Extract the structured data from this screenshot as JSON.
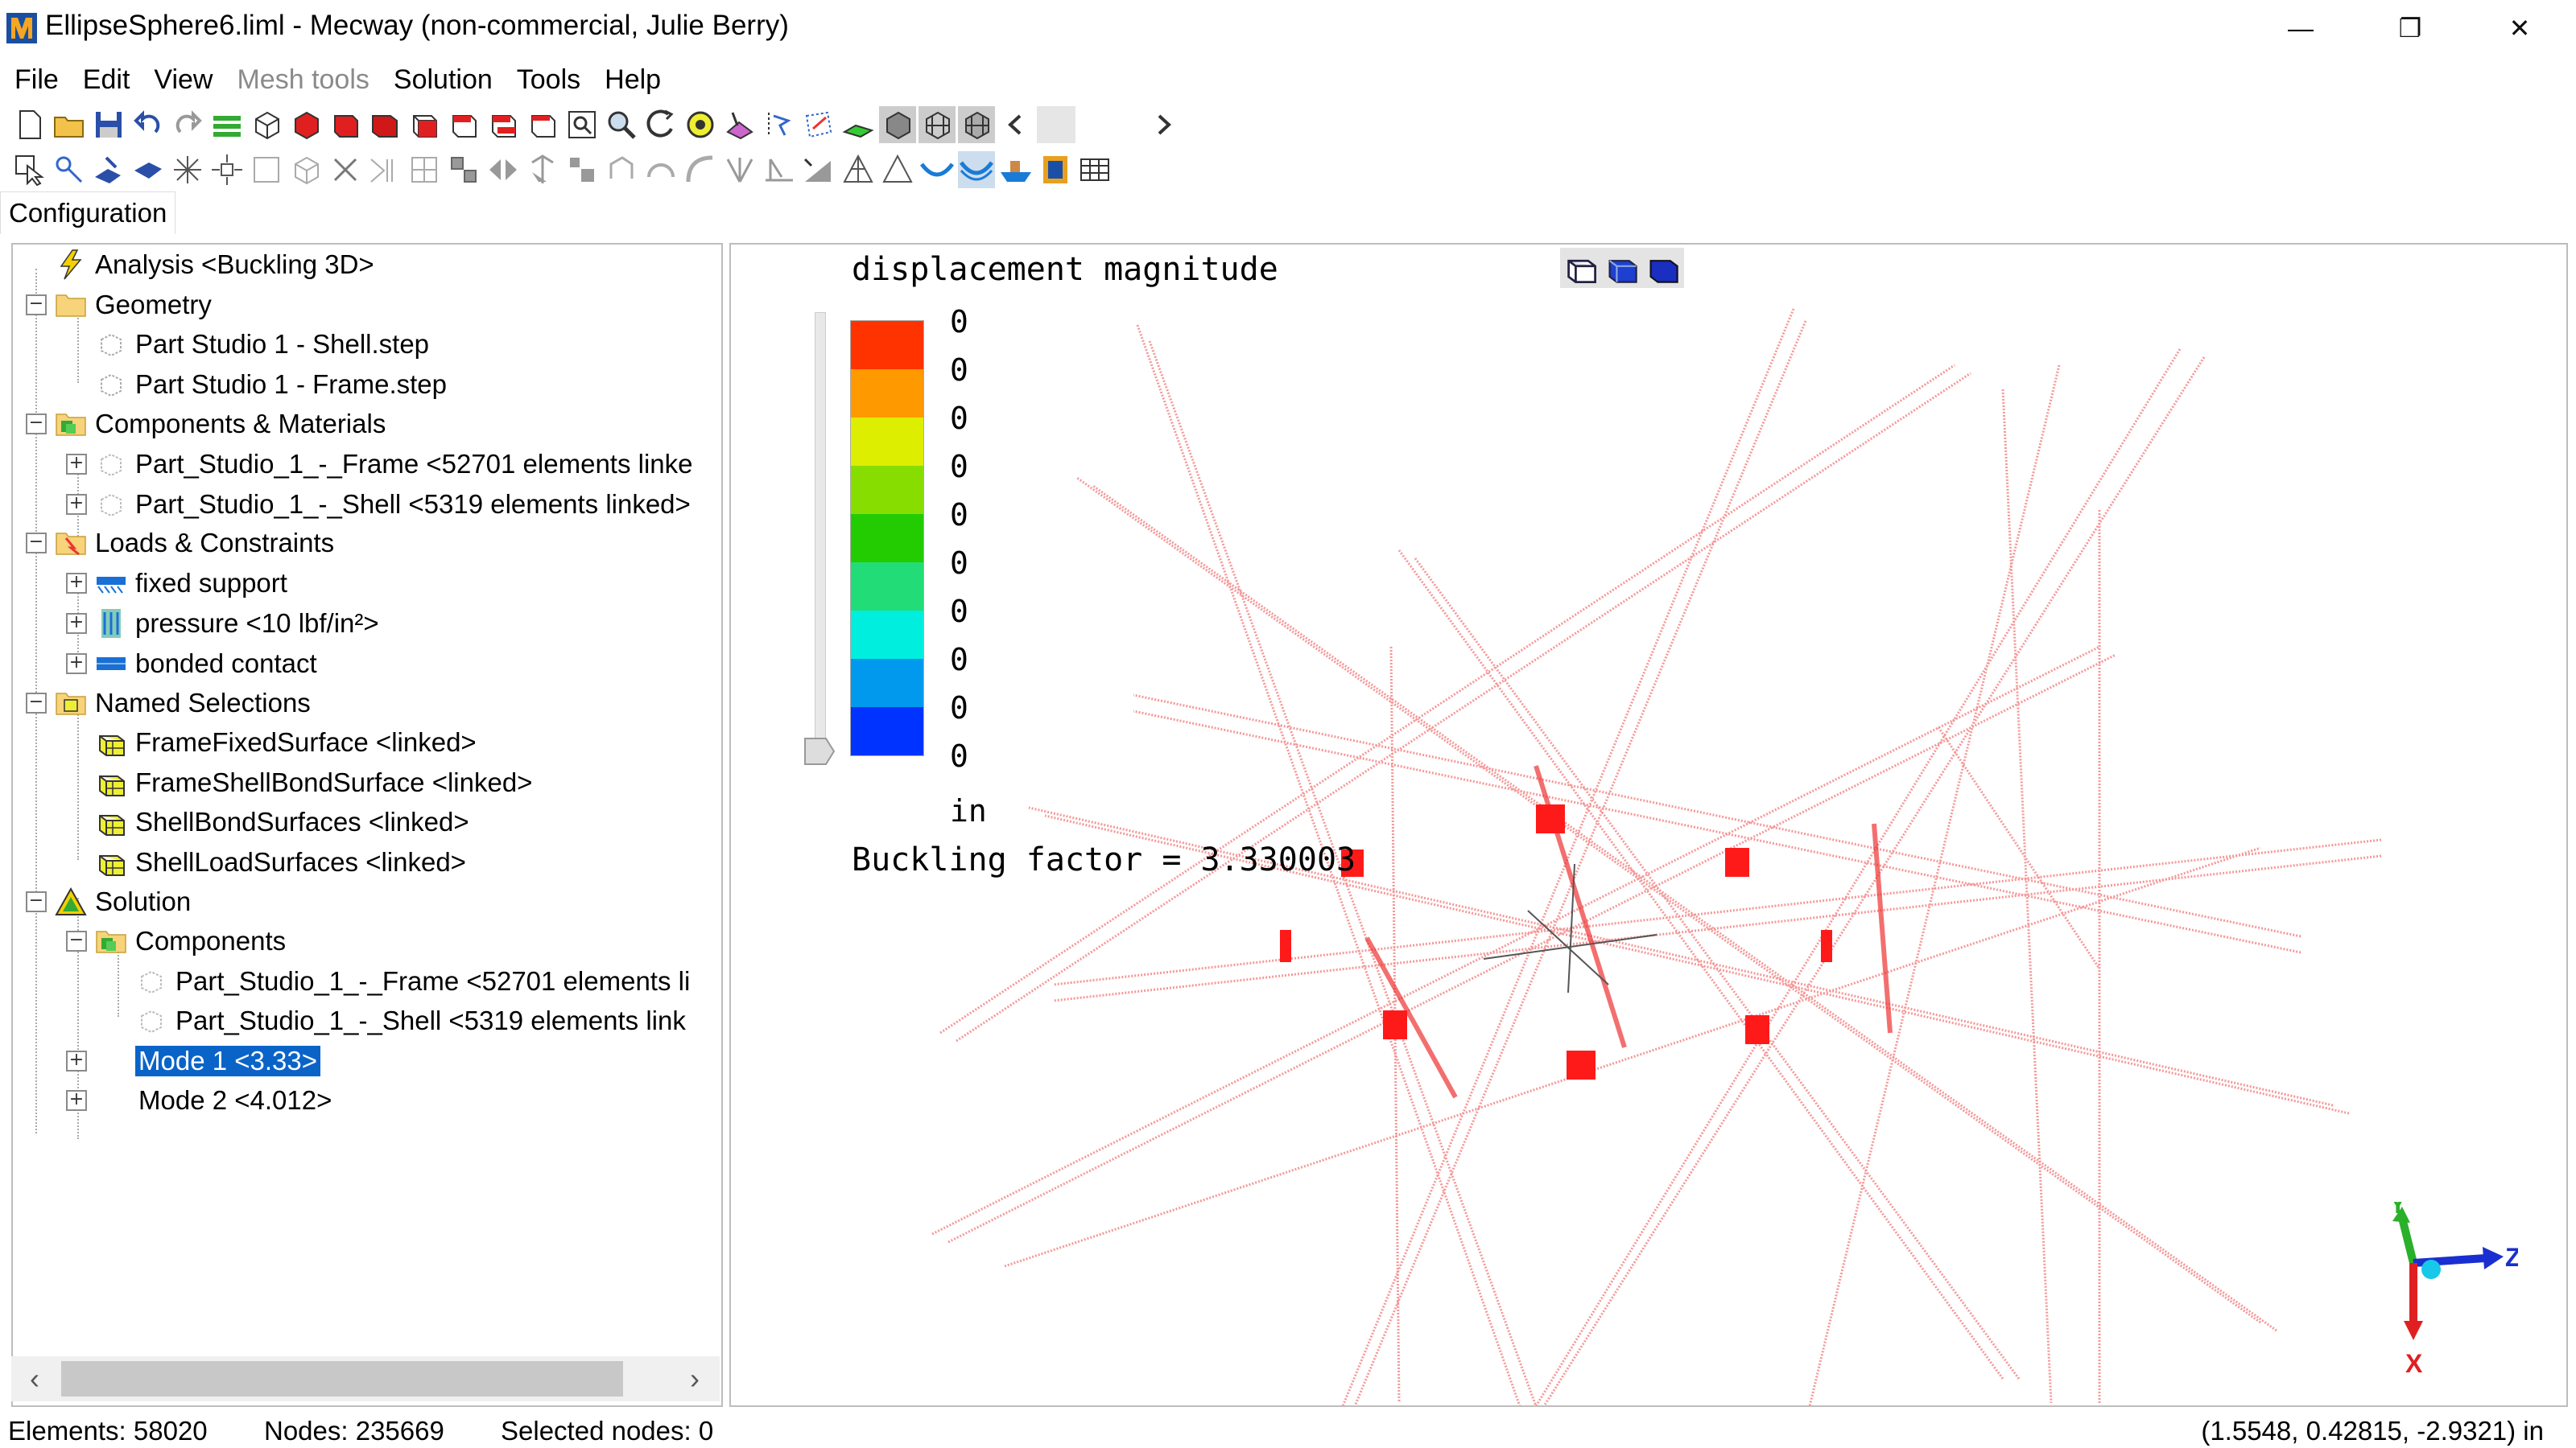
{
  "window": {
    "title": "EllipseSphere6.liml - Mecway (non-commercial, Julie Berry)",
    "minimize": "—",
    "restore": "❐",
    "close": "✕"
  },
  "menu": [
    "File",
    "Edit",
    "View",
    "Mesh tools",
    "Solution",
    "Tools",
    "Help"
  ],
  "tabs": {
    "configuration": "Configuration"
  },
  "tree": {
    "analysis": "Analysis <Buckling 3D>",
    "geometry": "Geometry",
    "geometry_items": [
      "Part Studio 1 - Shell.step",
      "Part Studio 1 - Frame.step"
    ],
    "components_materials": "Components & Materials",
    "component_items": [
      "Part_Studio_1_-_Frame <52701 elements linke",
      "Part_Studio_1_-_Shell <5319 elements linked>"
    ],
    "loads_constraints": "Loads & Constraints",
    "load_items": [
      "fixed support",
      "pressure <10 lbf/in²>",
      "bonded contact"
    ],
    "named_selections": "Named Selections",
    "named_items": [
      "FrameFixedSurface <linked>",
      "FrameShellBondSurface <linked>",
      "ShellBondSurfaces <linked>",
      "ShellLoadSurfaces <linked>"
    ],
    "solution": "Solution",
    "solution_components": "Components",
    "solution_component_items": [
      "Part_Studio_1_-_Frame <52701 elements li",
      "Part_Studio_1_-_Shell <5319 elements link"
    ],
    "modes": [
      "Mode 1 <3.33>",
      "Mode 2 <4.012>"
    ]
  },
  "viewport": {
    "legend_title": "displacement magnitude",
    "legend_values": [
      "0",
      "0",
      "0",
      "0",
      "0",
      "0",
      "0",
      "0",
      "0",
      "0"
    ],
    "legend_colors": [
      "#ff3300",
      "#ff9900",
      "#ddee00",
      "#88dd00",
      "#22cc00",
      "#22dd77",
      "#00eedd",
      "#0099ee",
      "#0033ff"
    ],
    "legend_unit": "in",
    "buckling_label": "Buckling factor = 3.330003",
    "axes": {
      "x": "X",
      "y": "Y",
      "z": "Z"
    }
  },
  "status": {
    "elements": "Elements: 58020",
    "nodes": "Nodes: 235669",
    "selected": "Selected nodes: 0",
    "coords": "(1.5548, 0.42815, -2.9321) in"
  }
}
